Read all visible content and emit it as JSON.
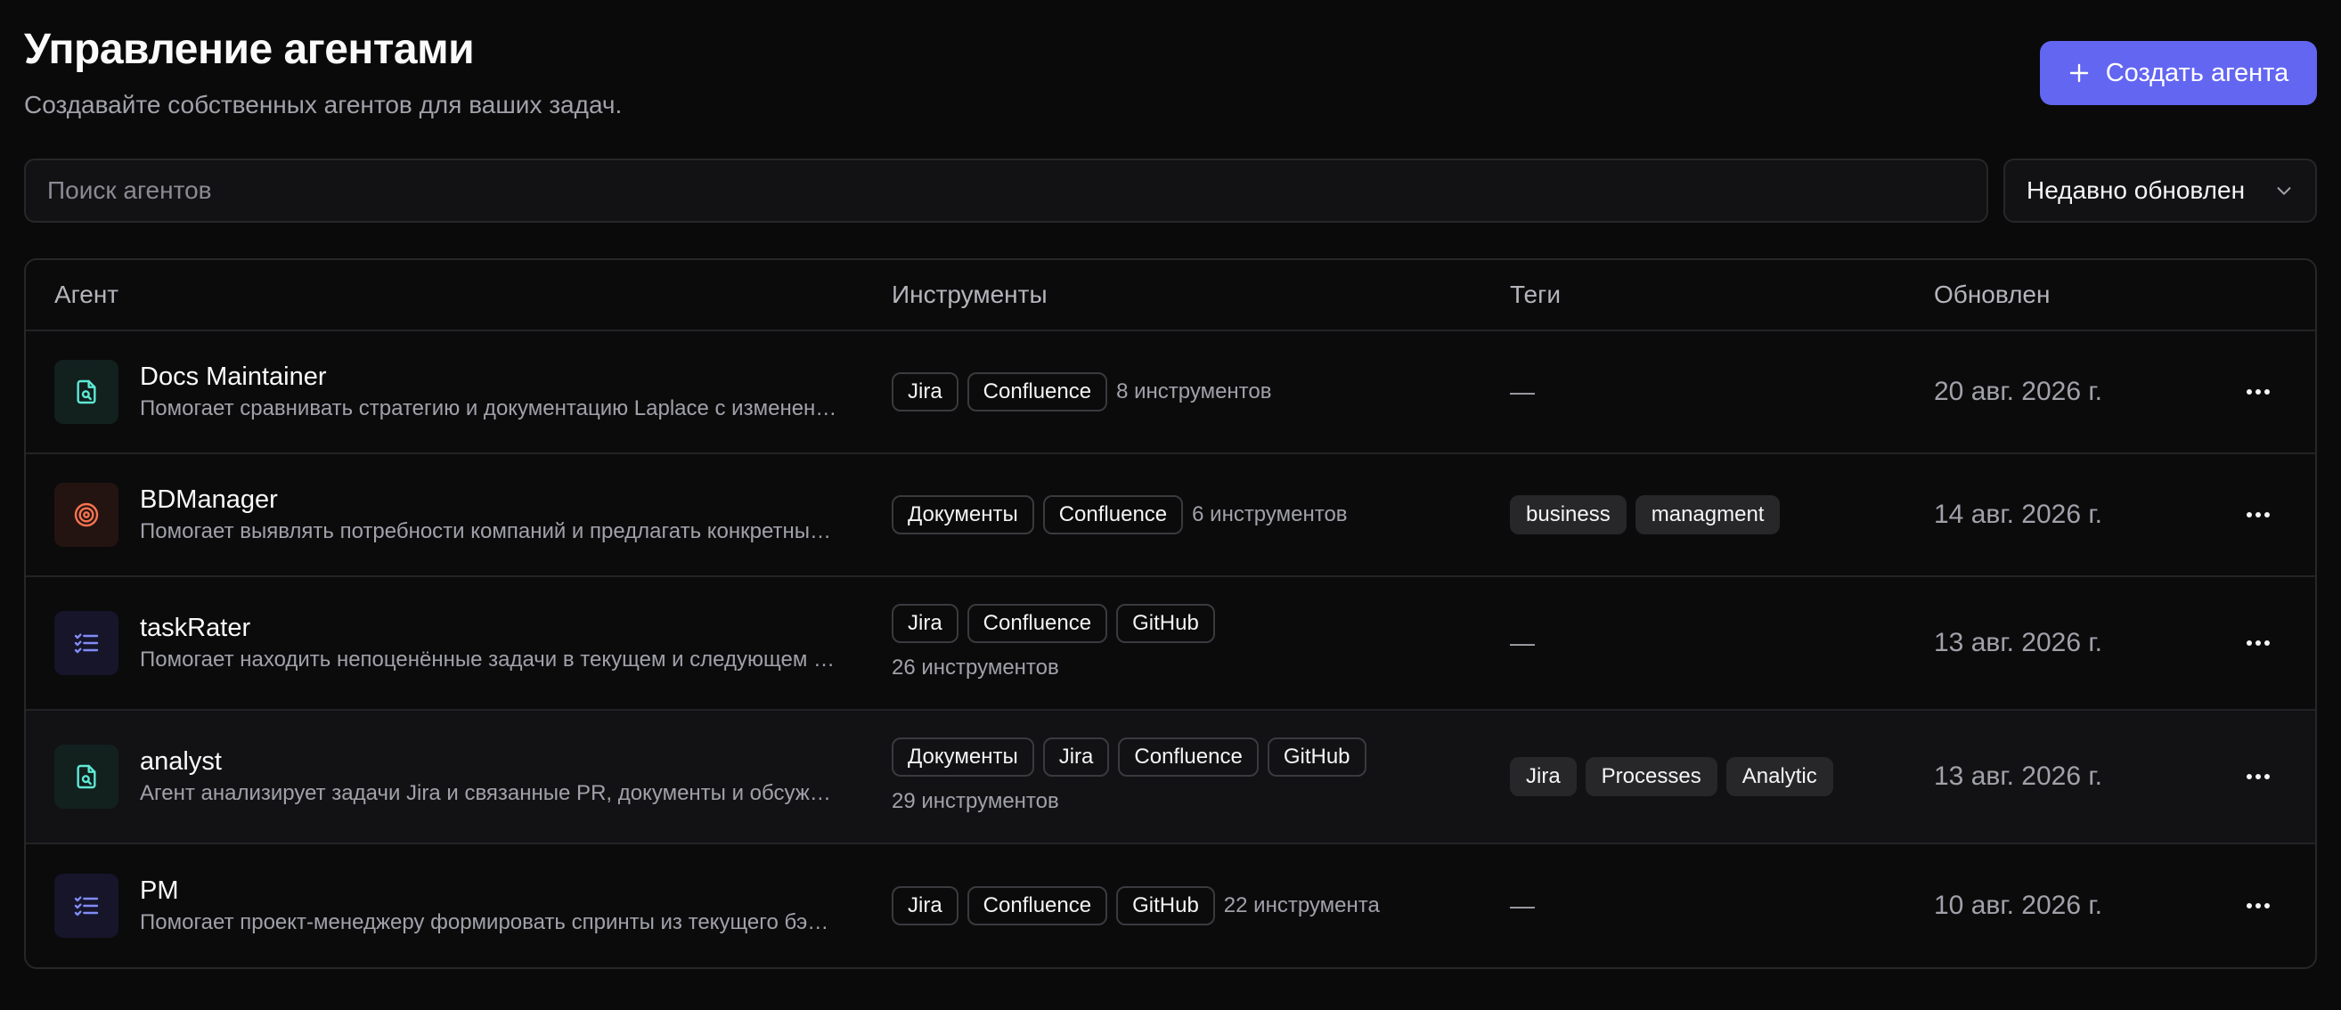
{
  "header": {
    "title": "Управление агентами",
    "subtitle": "Создавайте собственных агентов для ваших задач.",
    "create_label": "Создать агента"
  },
  "toolbar": {
    "search_placeholder": "Поиск агентов",
    "sort_label": "Недавно обновлен"
  },
  "table": {
    "columns": {
      "agent": "Агент",
      "tools": "Инструменты",
      "tags": "Теги",
      "updated": "Обновлен"
    },
    "rows": [
      {
        "name": "Docs Maintainer",
        "description": "Помогает сравнивать стратегию и документацию Laplace с изменен…",
        "icon": "doc-search-icon",
        "icon_color": "#5eead4",
        "icon_bg": "#12201e",
        "tools": [
          "Jira",
          "Confluence"
        ],
        "tools_count": "8 инструментов",
        "tags": [],
        "tags_empty": "—",
        "updated": "20 авг. 2026 г."
      },
      {
        "name": "BDManager",
        "description": "Помогает выявлять потребности компаний и предлагать конкретны…",
        "icon": "target-icon",
        "icon_color": "#f97350",
        "icon_bg": "#241411",
        "tools": [
          "Документы",
          "Confluence"
        ],
        "tools_count": "6 инструментов",
        "tags": [
          "business",
          "managment"
        ],
        "tags_empty": "",
        "updated": "14 авг. 2026 г."
      },
      {
        "name": "taskRater",
        "description": "Помогает находить непоценённые задачи в текущем и следующем …",
        "icon": "checklist-icon",
        "icon_color": "#818cf8",
        "icon_bg": "#16152a",
        "tools": [
          "Jira",
          "Confluence",
          "GitHub"
        ],
        "tools_count": "26 инструментов",
        "tags": [],
        "tags_empty": "—",
        "updated": "13 авг. 2026 г."
      },
      {
        "name": "analyst",
        "description": "Агент анализирует задачи Jira и связанные PR, документы и обсуж…",
        "icon": "doc-search-icon",
        "icon_color": "#5eead4",
        "icon_bg": "#12201e",
        "tools": [
          "Документы",
          "Jira",
          "Confluence",
          "GitHub"
        ],
        "tools_count": "29 инструментов",
        "tags": [
          "Jira",
          "Processes",
          "Analytic"
        ],
        "tags_empty": "",
        "updated": "13 авг. 2026 г."
      },
      {
        "name": "PM",
        "description": "Помогает проект-менеджеру формировать спринты из текущего бэ…",
        "icon": "checklist-icon",
        "icon_color": "#818cf8",
        "icon_bg": "#16152a",
        "tools": [
          "Jira",
          "Confluence",
          "GitHub"
        ],
        "tools_count": "22 инструмента",
        "tags": [],
        "tags_empty": "—",
        "updated": "10 авг. 2026 г."
      }
    ]
  },
  "colors": {
    "accent": "#6366f1",
    "background": "#0a0a0b"
  }
}
